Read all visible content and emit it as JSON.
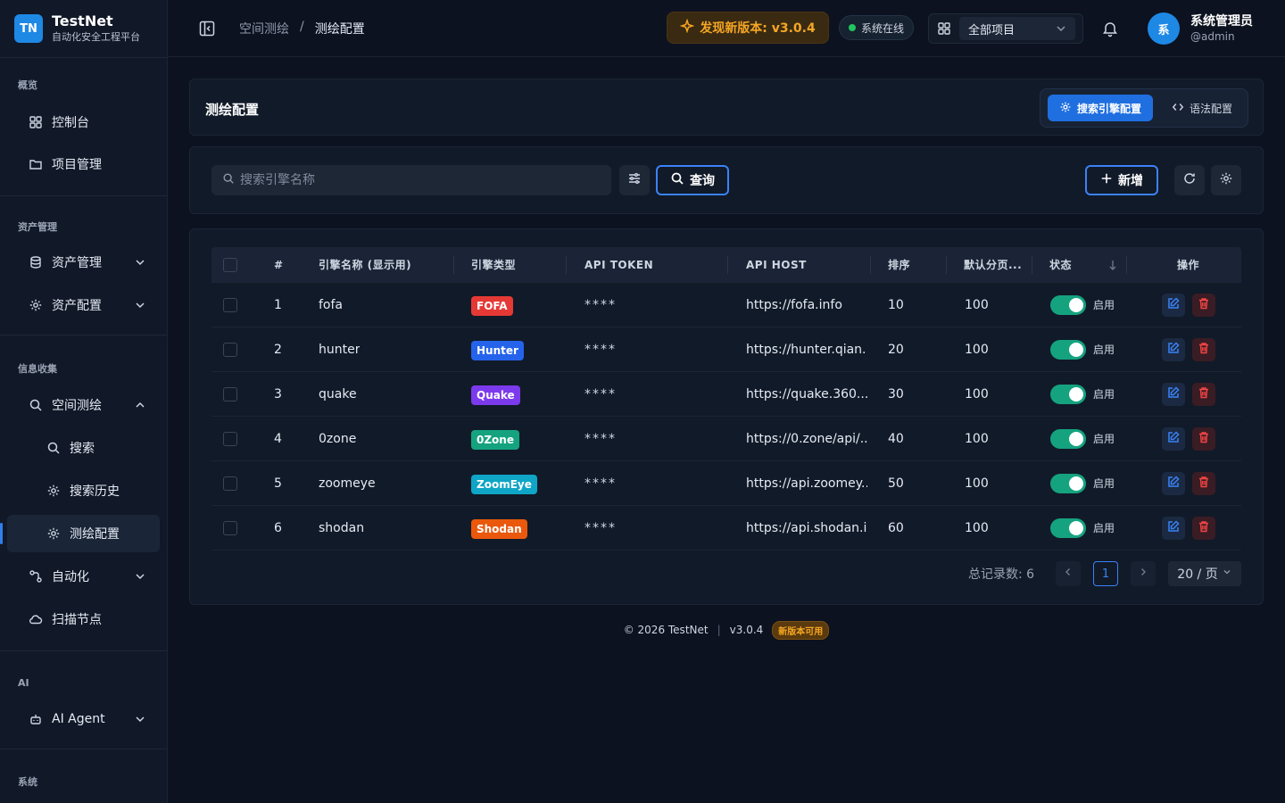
{
  "brand": {
    "logo": "TN",
    "name": "TestNet",
    "subtitle": "自动化安全工程平台"
  },
  "sidebar": {
    "sections": [
      {
        "title": "概览",
        "items": [
          {
            "label": "控制台",
            "icon": "grid-icon"
          },
          {
            "label": "项目管理",
            "icon": "folder-icon"
          }
        ]
      },
      {
        "title": "资产管理",
        "items": [
          {
            "label": "资产管理",
            "icon": "database-icon",
            "expandable": true
          },
          {
            "label": "资产配置",
            "icon": "gear-icon",
            "expandable": true
          }
        ]
      },
      {
        "title": "信息收集",
        "items": [
          {
            "label": "空间测绘",
            "icon": "search-icon",
            "expanded": true
          },
          {
            "label": "搜索",
            "icon": "search-icon"
          },
          {
            "label": "搜索历史",
            "icon": "gear-icon"
          },
          {
            "label": "测绘配置",
            "icon": "gear-icon",
            "active": true
          },
          {
            "label": "自动化",
            "icon": "workflow-icon",
            "expandable": true
          },
          {
            "label": "扫描节点",
            "icon": "cloud-icon"
          }
        ]
      },
      {
        "title": "AI",
        "items": [
          {
            "label": "AI Agent",
            "icon": "robot-icon",
            "expandable": true
          }
        ]
      },
      {
        "title": "系统",
        "items": []
      }
    ]
  },
  "header": {
    "breadcrumb": [
      "空间测绘",
      "/",
      "测绘配置"
    ],
    "update_label": "发现新版本: v3.0.4",
    "status_label": "系统在线",
    "project_select": "全部项目",
    "avatar_text": "系",
    "user_name": "系统管理员",
    "user_id": "@admin"
  },
  "page": {
    "title": "测绘配置",
    "tabs": [
      "搜索引擎配置",
      "语法配置"
    ]
  },
  "toolbar": {
    "search_placeholder": "搜索引擎名称",
    "query_label": "查询",
    "add_label": "新增"
  },
  "table": {
    "columns": [
      "#",
      "引擎名称 (显示用)",
      "引擎类型",
      "API TOKEN",
      "API HOST",
      "排序",
      "默认分页...",
      "状态",
      "操作"
    ],
    "rows": [
      {
        "index": "1",
        "name": "fofa",
        "type": "FOFA",
        "type_color": "#e53935",
        "token": "****",
        "host": "https://fofa.info",
        "sort": "10",
        "page_size": "100",
        "status": "启用"
      },
      {
        "index": "2",
        "name": "hunter",
        "type": "Hunter",
        "type_color": "#2563eb",
        "token": "****",
        "host": "https://hunter.qian...",
        "sort": "20",
        "page_size": "100",
        "status": "启用"
      },
      {
        "index": "3",
        "name": "quake",
        "type": "Quake",
        "type_color": "#7c3aed",
        "token": "****",
        "host": "https://quake.360....",
        "sort": "30",
        "page_size": "100",
        "status": "启用"
      },
      {
        "index": "4",
        "name": "0zone",
        "type": "0Zone",
        "type_color": "#15a37f",
        "token": "****",
        "host": "https://0.zone/api/...",
        "sort": "40",
        "page_size": "100",
        "status": "启用"
      },
      {
        "index": "5",
        "name": "zoomeye",
        "type": "ZoomEye",
        "type_color": "#0ea5c6",
        "token": "****",
        "host": "https://api.zoomey...",
        "sort": "50",
        "page_size": "100",
        "status": "启用"
      },
      {
        "index": "6",
        "name": "shodan",
        "type": "Shodan",
        "type_color": "#ea580c",
        "token": "****",
        "host": "https://api.shodan.i...",
        "sort": "60",
        "page_size": "100",
        "status": "启用"
      }
    ]
  },
  "pagination": {
    "total": "总记录数: 6",
    "current": "1",
    "size": "20 / 页"
  },
  "footer": {
    "copyright": "© 2026 TestNet",
    "version": "v3.0.4",
    "badge": "新版本可用"
  },
  "colors": {
    "accent": "#3b82f6",
    "success": "#15a37f",
    "warning": "#f5a623",
    "danger": "#ef4444"
  }
}
